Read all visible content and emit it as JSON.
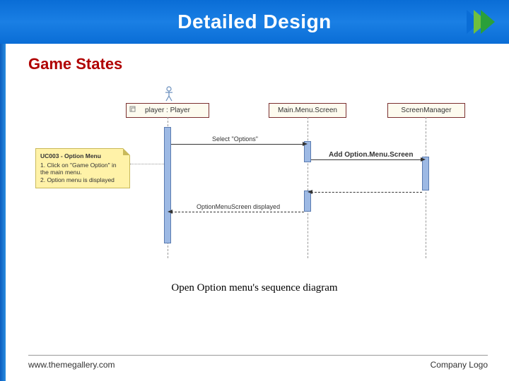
{
  "header": {
    "title": "Detailed Design"
  },
  "section": {
    "heading": "Game States"
  },
  "diagram": {
    "lifelines": {
      "player": "player : Player",
      "mainMenu": "Main.Menu.Screen",
      "screenManager": "ScreenManager"
    },
    "messages": {
      "selectOptions": "Select \"Options\"",
      "addOption": "Add Option.Menu.Screen",
      "displayed": "OptionMenuScreen displayed"
    },
    "note": {
      "title": "UC003 - Option Menu",
      "line1": "1. Click on \"Game Option\" in the main menu.",
      "line2": "2. Option menu is displayed"
    }
  },
  "caption": "Open Option menu's sequence diagram",
  "footer": {
    "url": "www.themegallery.com",
    "logo": "Company Logo"
  }
}
